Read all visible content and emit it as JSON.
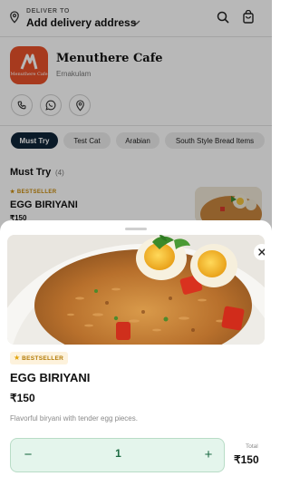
{
  "header": {
    "deliver_small": "DELIVER TO",
    "deliver_main": "Add delivery address"
  },
  "restaurant": {
    "name": "Menuthere Cafe",
    "location": "Ernakulam",
    "logo_text": "Menuthere Cafe"
  },
  "tabs": [
    {
      "label": "Must Try",
      "active": true
    },
    {
      "label": "Test Cat",
      "active": false
    },
    {
      "label": "Arabian",
      "active": false
    },
    {
      "label": "South Style Bread Items",
      "active": false
    }
  ],
  "section": {
    "title": "Must Try",
    "count": "(4)"
  },
  "background_item": {
    "badge": "BESTSELLER",
    "name": "EGG BIRIYANI",
    "price": "₹150"
  },
  "sheet": {
    "badge": "BESTSELLER",
    "item_name": "EGG BIRIYANI",
    "price": "₹150",
    "description": "Flavorful biryani with tender egg pieces.",
    "quantity": "1",
    "minus": "−",
    "plus": "+",
    "total_label": "Total",
    "total_value": "₹150"
  },
  "icons": {
    "location": "location-pin-icon",
    "chevron": "chevron-down-icon",
    "search": "search-icon",
    "bag": "shopping-bag-icon",
    "phone": "phone-icon",
    "whatsapp": "whatsapp-icon",
    "map": "map-pin-icon",
    "close": "close-icon",
    "star": "star-icon"
  },
  "colors": {
    "brand_orange": "#e8512a",
    "active_tab": "#0f2438",
    "stepper_bg": "#e4f5ec",
    "stepper_text": "#1d6b43",
    "bestseller_gold": "#c98a08"
  }
}
